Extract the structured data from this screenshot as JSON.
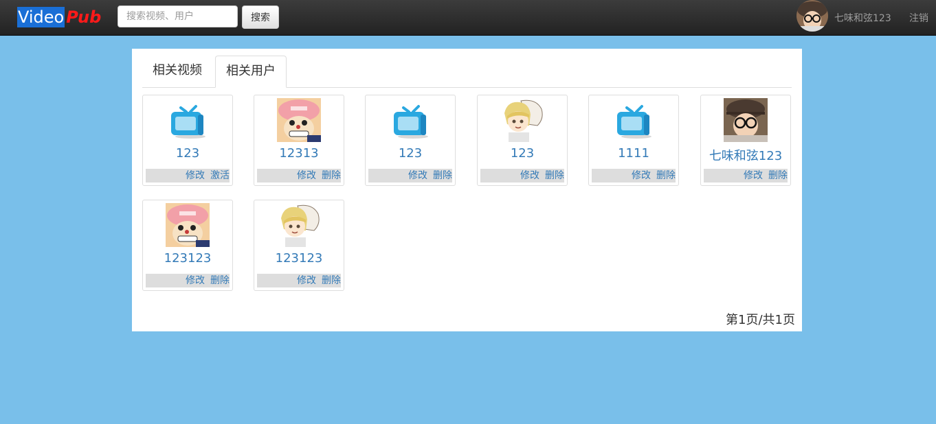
{
  "brand": {
    "part1": "Video",
    "part2": "Pub"
  },
  "search": {
    "placeholder": "搜索视频、用户",
    "button_label": "搜索"
  },
  "user": {
    "name": "七味和弦123",
    "logout_label": "注销"
  },
  "tabs": [
    {
      "label": "相关视频",
      "active": false
    },
    {
      "label": "相关用户",
      "active": true
    }
  ],
  "cards": [
    {
      "name": "123",
      "icon": "tv-icon",
      "actions": [
        "修改",
        "激活"
      ]
    },
    {
      "name": "12313",
      "icon": "chopper-avatar",
      "actions": [
        "修改",
        "删除"
      ]
    },
    {
      "name": "123",
      "icon": "tv-icon",
      "actions": [
        "修改",
        "删除"
      ]
    },
    {
      "name": "123",
      "icon": "anime-boy-avatar",
      "actions": [
        "修改",
        "删除"
      ]
    },
    {
      "name": "1111",
      "icon": "tv-icon",
      "actions": [
        "修改",
        "删除"
      ]
    },
    {
      "name": "七味和弦123",
      "icon": "kid-glasses-avatar",
      "actions": [
        "修改",
        "删除"
      ]
    },
    {
      "name": "123123",
      "icon": "chopper-avatar",
      "actions": [
        "修改",
        "删除"
      ]
    },
    {
      "name": "123123",
      "icon": "anime-boy-avatar",
      "actions": [
        "修改",
        "删除"
      ]
    }
  ],
  "pager": {
    "text": "第1页/共1页"
  },
  "colors": {
    "background": "#79bfea",
    "navbar": "#222222",
    "link": "#337ab7",
    "brand_blue": "#1a6fd6",
    "brand_red": "#ff1a1a"
  }
}
